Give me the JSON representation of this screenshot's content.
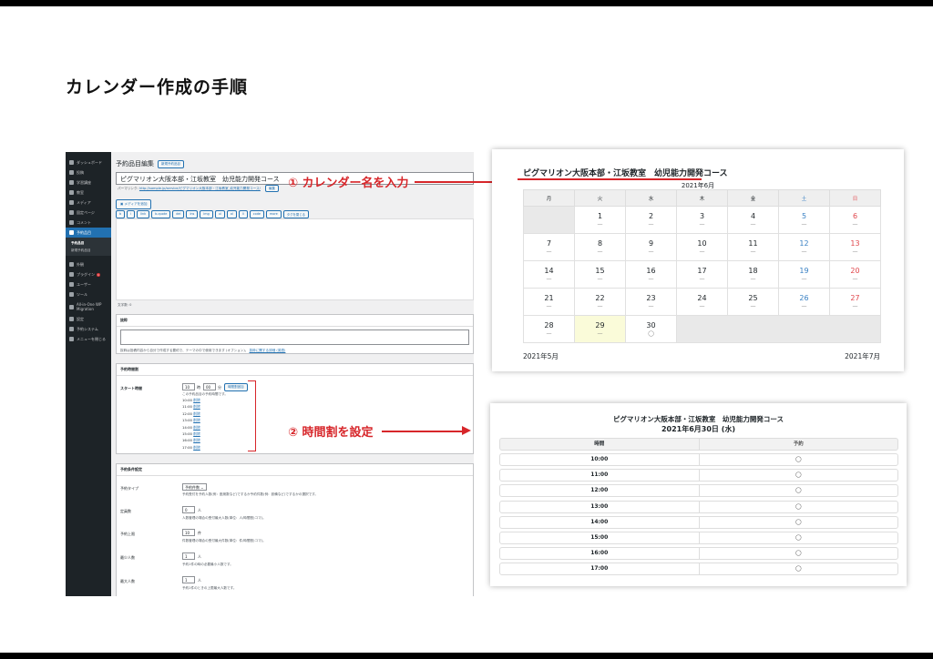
{
  "title": "カレンダー作成の手順",
  "wp": {
    "sidebar": [
      {
        "label": "ダッシュボード"
      },
      {
        "label": "投稿"
      },
      {
        "label": "学習講座"
      },
      {
        "label": "教室"
      },
      {
        "label": "メディア"
      },
      {
        "label": "固定ページ"
      },
      {
        "label": "コメント"
      },
      {
        "label": "予約品目"
      },
      {
        "label": "外観"
      },
      {
        "label": "プラグイン"
      },
      {
        "label": "ユーザー"
      },
      {
        "label": "ツール"
      },
      {
        "label": "All-in-One WP Migration"
      },
      {
        "label": "設定"
      },
      {
        "label": "予約システム"
      },
      {
        "label": "メニューを閉じる"
      }
    ],
    "submenu": [
      "予約品目",
      "新規予約品目"
    ],
    "plugin_badge": "1",
    "page_title": "予約品目編集",
    "add_new": "新規予約品目",
    "post_title": "ピグマリオン大阪本部・江坂教室　幼児能力開発コース",
    "permalink_label": "パーマリンク:",
    "permalink_url": "http://sample.jp/service/ピグマリオン大阪本部・江坂教室_幼児能力開発コース/",
    "permalink_edit": "編集",
    "add_media": "メディアを追加",
    "quicktags": [
      "b",
      "i",
      "link",
      "b-quote",
      "del",
      "ins",
      "img",
      "ul",
      "ol",
      "li",
      "code",
      "more",
      "タグを閉じる"
    ],
    "word_count": "文字数: 0",
    "excerpt_heading": "抜粋",
    "excerpt_help": "抜粋は投稿内容から自分で作成する要約で、テーマの中で使用できます (オプション)。",
    "excerpt_link": "抜粋に関する詳細 (英語)",
    "time_heading": "予約時間割",
    "start_label": "スタート時間",
    "start_hour": "10",
    "start_minute": "00",
    "start_h_unit": "時",
    "start_m_unit": "分",
    "time_btn": "時間割追加",
    "time_note": "この予約品目の予約時間です。",
    "times": [
      "10:00",
      "11:00",
      "12:00",
      "13:00",
      "14:00",
      "15:00",
      "16:00",
      "17:00"
    ],
    "delete": "削除",
    "cond_heading": "予約条件設定",
    "type_label": "予約タイプ",
    "type_value": "予約件数",
    "type_help": "予約受付を予約人数(例：座席数など)でするか予約件数(例：設備など)でするかの選択です。",
    "cap_label": "定員数",
    "cap_value": "0",
    "cap_unit": "人",
    "cap_help": "人数管理の場合の受付最大人数(単位：人/時間割)コマ)。",
    "limit_label": "予約上限",
    "limit_value": "10",
    "limit_unit": "件",
    "limit_help": "件数管理の場合の受付最大件数(単位：件/時間割)コマ)。",
    "min_label": "最少人数",
    "min_value": "1",
    "min_unit": "人",
    "min_help": "予約1件の時の必要最小人数です。",
    "max_label": "最大人数",
    "max_value": "1",
    "max_unit": "人",
    "max_help": "予約1件のときの上限最大人数です。"
  },
  "annotations": {
    "step1": "① カレンダー名を入力",
    "step2": "② 時間割を設定"
  },
  "calendar": {
    "title": "ピグマリオン大阪本部・江坂教室　幼児能力開発コース",
    "month": "2021年6月",
    "weekdays": [
      "月",
      "火",
      "水",
      "木",
      "金",
      "土",
      "日"
    ],
    "weeks": [
      [
        null,
        "1",
        "2",
        "3",
        "4",
        "5",
        "6"
      ],
      [
        "7",
        "8",
        "9",
        "10",
        "11",
        "12",
        "13"
      ],
      [
        "14",
        "15",
        "16",
        "17",
        "18",
        "19",
        "20"
      ],
      [
        "21",
        "22",
        "23",
        "24",
        "25",
        "26",
        "27"
      ],
      [
        "28",
        "29",
        "30",
        null,
        null,
        null,
        null
      ]
    ],
    "mark_closed": "—",
    "mark_open": "◯",
    "open_day": "30",
    "today": "29",
    "prev": "2021年5月",
    "next": "2021年7月"
  },
  "timetable": {
    "title": "ピグマリオン大阪本部・江坂教室　幼児能力開発コース",
    "date": "2021年6月30日 (水)",
    "col_time": "時間",
    "col_reserve": "予約",
    "rows": [
      "10:00",
      "11:00",
      "12:00",
      "13:00",
      "14:00",
      "15:00",
      "16:00",
      "17:00"
    ],
    "mark": "◯"
  },
  "colors": {
    "accent_red": "#d7262a",
    "wp_sidebar": "#1d2327",
    "wp_active": "#2271b1",
    "saturday": "#3b82c4",
    "sunday": "#e0474c",
    "today_bg": "#fafbd9"
  }
}
